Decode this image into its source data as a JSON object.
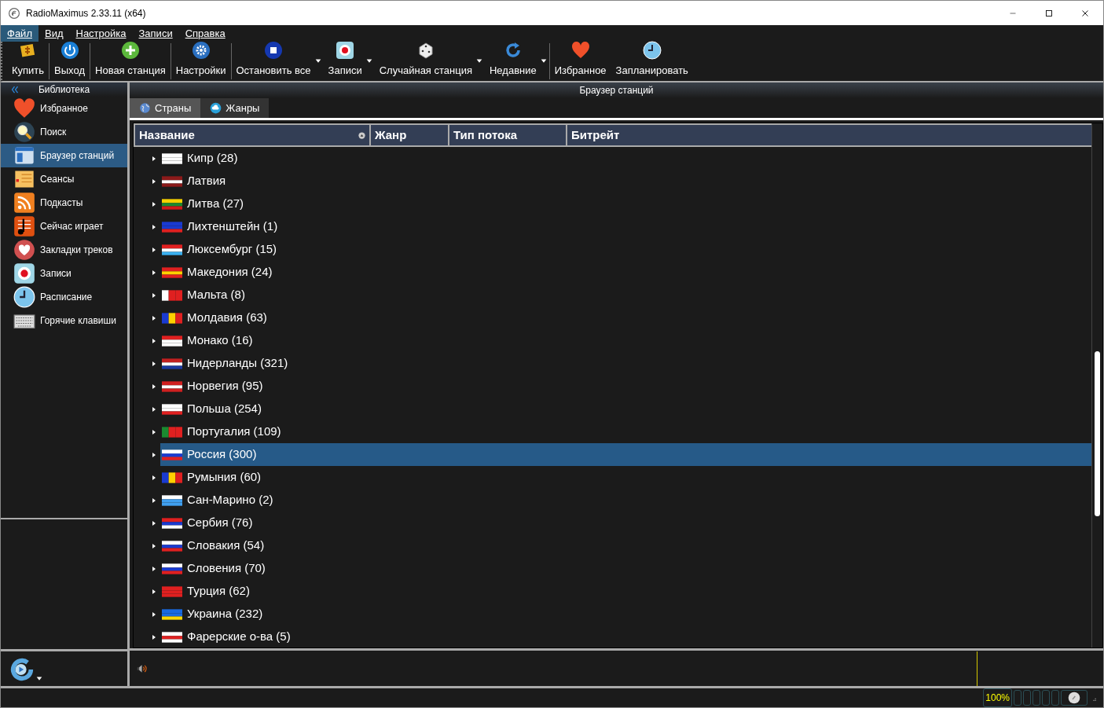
{
  "window": {
    "title": "RadioMaximus 2.33.11 (x64)"
  },
  "menu": [
    {
      "label": "Файл",
      "selected": true
    },
    {
      "label": "Вид",
      "selected": false
    },
    {
      "label": "Настройка",
      "selected": false
    },
    {
      "label": "Записи",
      "selected": false
    },
    {
      "label": "Справка",
      "selected": false
    }
  ],
  "toolbar": [
    {
      "label": "Купить",
      "kind": "buy",
      "dropdown": false,
      "separator_after": true
    },
    {
      "label": "Выход",
      "kind": "power",
      "dropdown": false,
      "separator_after": true
    },
    {
      "label": "Новая станция",
      "kind": "add",
      "dropdown": false,
      "separator_after": true
    },
    {
      "label": "Настройки",
      "kind": "settings",
      "dropdown": false,
      "separator_after": true
    },
    {
      "label": "Остановить все",
      "kind": "stop",
      "dropdown": true,
      "separator_after": false
    },
    {
      "label": "Записи",
      "kind": "record",
      "dropdown": true,
      "separator_after": false
    },
    {
      "label": "Случайная станция",
      "kind": "dice",
      "dropdown": true,
      "separator_after": false
    },
    {
      "label": "Недавние",
      "kind": "refresh",
      "dropdown": true,
      "separator_after": true
    },
    {
      "label": "Избранное",
      "kind": "heart",
      "dropdown": false,
      "separator_after": false
    },
    {
      "label": "Запланировать",
      "kind": "clock",
      "dropdown": false,
      "separator_after": false
    }
  ],
  "sidebar": {
    "title": "Библиотека",
    "items": [
      {
        "label": "Избранное",
        "kind": "heart",
        "selected": false
      },
      {
        "label": "Поиск",
        "kind": "search",
        "selected": false
      },
      {
        "label": "Браузер станций",
        "kind": "browser",
        "selected": true
      },
      {
        "label": "Сеансы",
        "kind": "sessions",
        "selected": false
      },
      {
        "label": "Подкасты",
        "kind": "rss",
        "selected": false
      },
      {
        "label": "Сейчас играет",
        "kind": "note",
        "selected": false
      },
      {
        "label": "Закладки треков",
        "kind": "bookmark",
        "selected": false
      },
      {
        "label": "Записи",
        "kind": "record",
        "selected": false
      },
      {
        "label": "Расписание",
        "kind": "clock",
        "selected": false
      },
      {
        "label": "Горячие клавиши",
        "kind": "keyboard",
        "selected": false
      }
    ]
  },
  "panel": {
    "title": "Браузер станций",
    "tabs": [
      {
        "label": "Страны",
        "kind": "globe",
        "selected": true
      },
      {
        "label": "Жанры",
        "kind": "cloud",
        "selected": false
      }
    ],
    "table": {
      "columns": [
        "Название",
        "Жанр",
        "Тип потока",
        "Битрейт"
      ],
      "rows": [
        {
          "name": "Кипр (28)",
          "selected": false
        },
        {
          "name": "Латвия",
          "selected": false
        },
        {
          "name": "Литва (27)",
          "selected": false
        },
        {
          "name": "Лихтенштейн (1)",
          "selected": false
        },
        {
          "name": "Люксембург (15)",
          "selected": false
        },
        {
          "name": "Македония (24)",
          "selected": false
        },
        {
          "name": "Мальта (8)",
          "selected": false
        },
        {
          "name": "Молдавия (63)",
          "selected": false
        },
        {
          "name": "Монако (16)",
          "selected": false
        },
        {
          "name": "Нидерланды (321)",
          "selected": false
        },
        {
          "name": "Норвегия (95)",
          "selected": false
        },
        {
          "name": "Польша (254)",
          "selected": false
        },
        {
          "name": "Португалия (109)",
          "selected": false
        },
        {
          "name": "Россия (300)",
          "selected": true
        },
        {
          "name": "Румыния (60)",
          "selected": false
        },
        {
          "name": "Сан-Марино (2)",
          "selected": false
        },
        {
          "name": "Сербия (76)",
          "selected": false
        },
        {
          "name": "Словакия (54)",
          "selected": false
        },
        {
          "name": "Словения (70)",
          "selected": false
        },
        {
          "name": "Турция (62)",
          "selected": false
        },
        {
          "name": "Украина (232)",
          "selected": false
        },
        {
          "name": "Фарерские о-ва (5)",
          "selected": false
        }
      ]
    }
  },
  "status_bar": {
    "volume": "100%"
  }
}
